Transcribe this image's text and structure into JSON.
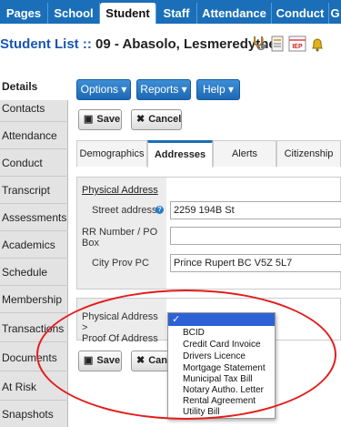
{
  "top_tabs": [
    "Pages",
    "School",
    "Student",
    "Staff",
    "Attendance",
    "Conduct",
    "G"
  ],
  "active_top_tab": "Student",
  "title": {
    "link": "Student List",
    "separator": "::",
    "student": "09 - Abasolo, Lesmeredythe"
  },
  "header_icons": [
    "stethoscope-icon",
    "notes-icon",
    "iep-icon",
    "alert-bell-icon"
  ],
  "header_icon_iep": "IEP",
  "sidebar": {
    "items": [
      "Details",
      "Contacts",
      "Attendance",
      "Conduct",
      "Transcript",
      "Assessments",
      "Academics",
      "Schedule",
      "Membership",
      "Transactions",
      "Documents",
      "At Risk",
      "Snapshots"
    ],
    "active": "Details"
  },
  "actions": {
    "options": "Options",
    "reports": "Reports",
    "help": "Help",
    "save": "Save",
    "cancel": "Cancel",
    "cancel_partial": "Canc"
  },
  "subtabs": [
    "Demographics",
    "Addresses",
    "Alerts",
    "Citizenship"
  ],
  "active_subtab": "Addresses",
  "form": {
    "section": "Physical Address",
    "street_label": "Street address",
    "street_value": "2259 194B St",
    "rr_label_1": "RR Number / PO",
    "rr_label_2": "Box",
    "rr_value": "",
    "city_label": "City Prov PC",
    "city_value": "Prince Rupert BC  V5Z 5L7"
  },
  "select_field": {
    "label_1": "Physical Address >",
    "label_2": "Proof Of Address",
    "selected": "✓",
    "options": [
      "BCID",
      "Credit Card Invoice",
      "Drivers Licence",
      "Mortgage Statement",
      "Municipal Tax Bill",
      "Notary Autho. Letter",
      "Rental Agreement",
      "Utility Bill"
    ]
  },
  "colors": {
    "nav_blue": "#1a6fb8",
    "highlight": "#2c62d6",
    "annotation_red": "#e21d1d"
  }
}
